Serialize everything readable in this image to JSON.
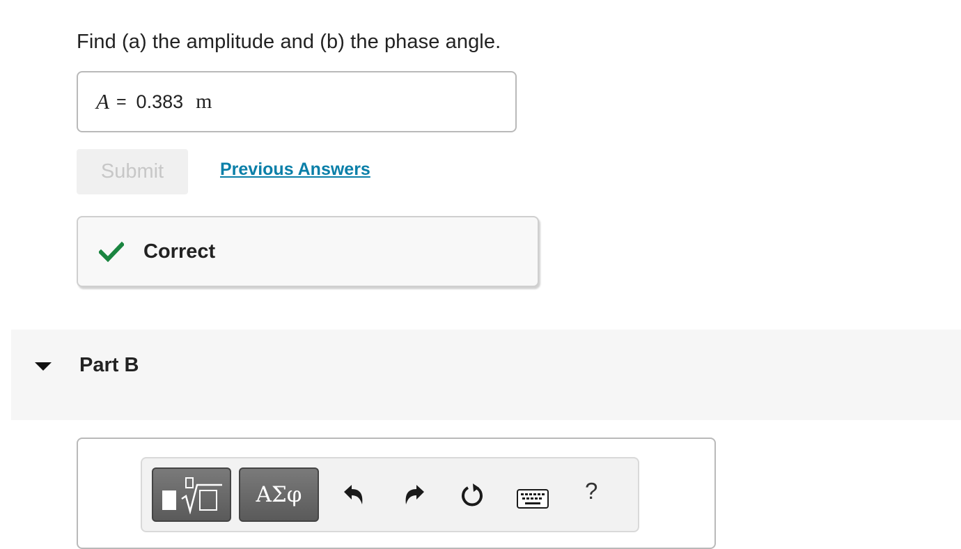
{
  "question": "Find (a) the amplitude and (b) the phase angle.",
  "answer": {
    "variable": "A",
    "equals": "=",
    "value": "0.383",
    "unit": "m"
  },
  "submit_label": "Submit",
  "previous_answers_label": "Previous Answers",
  "feedback": {
    "status": "Correct",
    "status_color": "#1a8540"
  },
  "part_b": {
    "title": "Part B"
  },
  "toolbar": {
    "symbols_label": "ΑΣφ",
    "help_label": "?"
  },
  "colors": {
    "link": "#0a7fa8",
    "correct": "#1a8540",
    "button_dark": "#666666"
  },
  "icons": [
    "check-icon",
    "caret-down-icon",
    "templates-icon",
    "undo-icon",
    "redo-icon",
    "reset-icon",
    "keyboard-icon"
  ]
}
